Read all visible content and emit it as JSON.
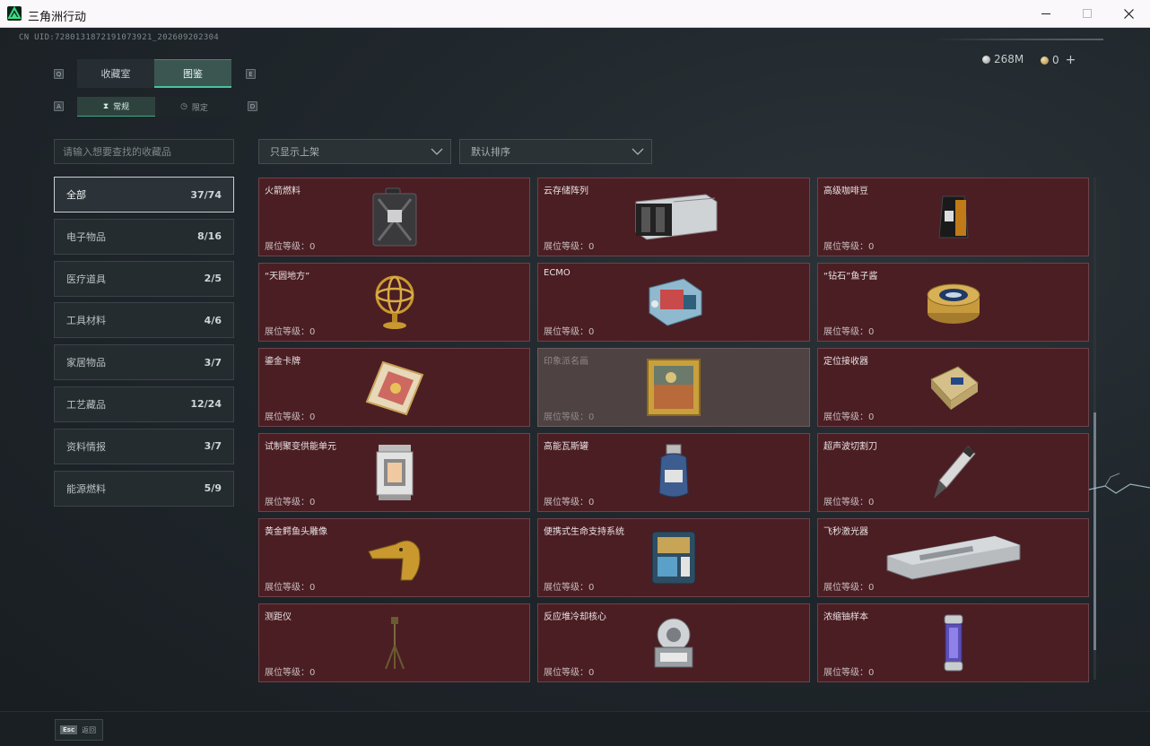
{
  "window": {
    "title": "三角洲行动",
    "min_icon": "minimize-icon",
    "max_icon": "maximize-icon",
    "close_icon": "close-icon"
  },
  "uid_text": "CN UID:7280131872191073921_202609202304",
  "currency": {
    "silver": "268M",
    "gold": "0",
    "plus": "+"
  },
  "keys": {
    "tab_prev": "Q",
    "tab_next": "E",
    "sub_prev": "A",
    "sub_next": "D"
  },
  "main_tabs": [
    {
      "label": "收藏室"
    },
    {
      "label": "图鉴"
    }
  ],
  "sub_tabs": [
    {
      "label": "常规",
      "icon": "hourglass-icon"
    },
    {
      "label": "限定",
      "icon": "clock-icon"
    }
  ],
  "search": {
    "placeholder": "请输入想要查找的收藏品"
  },
  "categories": [
    {
      "label": "全部",
      "count": "37/74"
    },
    {
      "label": "电子物品",
      "count": "8/16"
    },
    {
      "label": "医疗道具",
      "count": "2/5"
    },
    {
      "label": "工具材料",
      "count": "4/6"
    },
    {
      "label": "家居物品",
      "count": "3/7"
    },
    {
      "label": "工艺藏品",
      "count": "12/24"
    },
    {
      "label": "资料情报",
      "count": "3/7"
    },
    {
      "label": "能源燃料",
      "count": "5/9"
    }
  ],
  "filters": {
    "display": "只显示上架",
    "sort": "默认排序"
  },
  "level_label": "展位等级：0",
  "items": [
    {
      "name": "火箭燃料",
      "icon": "fuel-can-icon"
    },
    {
      "name": "云存储阵列",
      "icon": "storage-array-icon"
    },
    {
      "name": "高级咖啡豆",
      "icon": "coffee-bag-icon"
    },
    {
      "name": "“天圆地方”",
      "icon": "armillary-sphere-icon"
    },
    {
      "name": "ECMO",
      "icon": "ecmo-machine-icon"
    },
    {
      "name": "“钻石”鱼子酱",
      "icon": "caviar-tin-icon"
    },
    {
      "name": "鎏金卡牌",
      "icon": "gold-card-icon"
    },
    {
      "name": "印象派名画",
      "icon": "painting-icon"
    },
    {
      "name": "定位接收器",
      "icon": "receiver-icon"
    },
    {
      "name": "试制聚变供能单元",
      "icon": "fusion-unit-icon"
    },
    {
      "name": "高能瓦斯罐",
      "icon": "gas-tank-icon"
    },
    {
      "name": "超声波切割刀",
      "icon": "cutter-knife-icon"
    },
    {
      "name": "黄金鳄鱼头雕像",
      "icon": "croc-statue-icon"
    },
    {
      "name": "便携式生命支持系统",
      "icon": "life-support-icon"
    },
    {
      "name": "飞秒激光器",
      "icon": "laser-case-icon"
    },
    {
      "name": "测距仪",
      "icon": "tripod-rangefinder-icon"
    },
    {
      "name": "反应堆冷却核心",
      "icon": "reactor-core-icon"
    },
    {
      "name": "浓缩铀样本",
      "icon": "uranium-capsule-icon"
    }
  ],
  "esc": {
    "key": "Esc",
    "label": "返回"
  },
  "colors": {
    "accent": "#46c39a",
    "card_bg": "#4b1e23",
    "card_muted_bg": "#4f4243"
  }
}
